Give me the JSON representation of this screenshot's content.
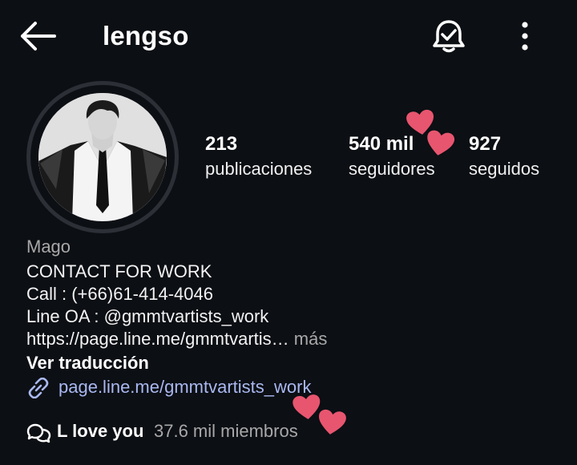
{
  "header": {
    "username": "lengso",
    "back_icon": "arrow-left-icon",
    "bell_icon": "bell-check-icon",
    "more_icon": "vertical-dots-icon"
  },
  "stats": {
    "posts": {
      "value": "213",
      "label": "publicaciones"
    },
    "followers": {
      "value": "540 mil",
      "label": "seguidores"
    },
    "following": {
      "value": "927",
      "label": "seguidos"
    }
  },
  "bio": {
    "category": "Mago",
    "lines": [
      "CONTACT FOR WORK",
      "Call : (+66)61-414-4046",
      "Line OA : @gmmtvartists_work",
      "https://page.line.me/gmmtvartis…"
    ],
    "more_label": " más",
    "translate_label": "Ver traducción",
    "link": "page.line.me/gmmtvartists_work"
  },
  "channel": {
    "name": "L love you",
    "members": "37.6 mil miembros"
  },
  "colors": {
    "background": "#0c0f14",
    "link": "#a9b8f0",
    "heart": "#e8556f",
    "muted": "#a8a8a8"
  }
}
